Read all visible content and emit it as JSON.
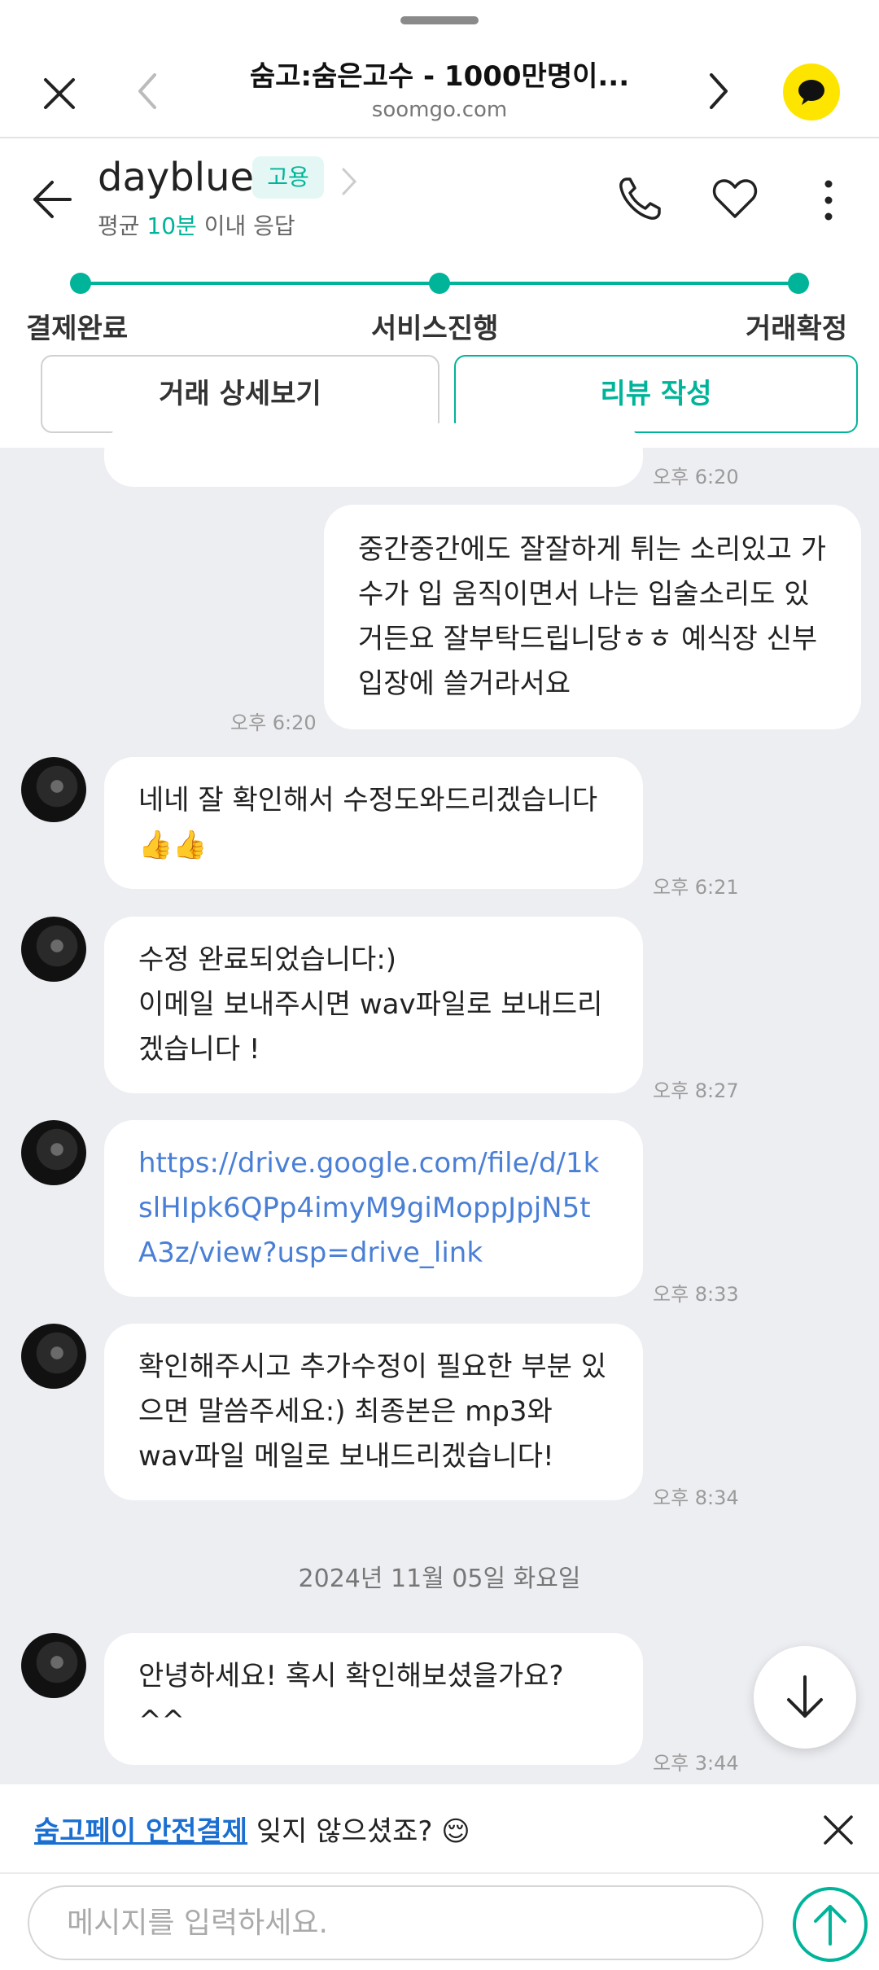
{
  "browser": {
    "title": "숨고:숨은고수 - 1000만명이...",
    "url": "soomgo.com"
  },
  "chat_header": {
    "partner_name": "dayblue",
    "badge": "고용",
    "response_prefix": "평균 ",
    "response_value": "10분",
    "response_suffix": " 이내 응답"
  },
  "progress": {
    "steps": [
      "결제완료",
      "서비스진행",
      "거래확정"
    ]
  },
  "actions": {
    "detail_label": "거래 상세보기",
    "review_label": "리뷰 작성"
  },
  "messages": [
    {
      "side": "right",
      "text": "중간중간에도 잘잘하게 튀는 소리있고 가수가 입 움직이면서 나는 입술소리도 있거든요 잘부탁드립니당ㅎㅎ 예식장 신부입장에 쓸거라서요",
      "time": "오후 6:20"
    },
    {
      "side": "left",
      "text": "네네 잘 확인해서 수정도와드리겠습니다 👍👍",
      "time": "오후 6:21"
    },
    {
      "side": "left",
      "text": "수정 완료되었습니다:)\n이메일 보내주시면 wav파일로 보내드리겠습니다 !",
      "time": "오후 8:27"
    },
    {
      "side": "left",
      "text": "https://drive.google.com/file/d/1kslHIpk6QPp4imyM9giMoppJpjN5tA3z/view?usp=drive_link",
      "time": "오후 8:33"
    },
    {
      "side": "left",
      "text": "확인해주시고 추가수정이 필요한 부분 있으면 말씀주세요:) 최종본은 mp3와 wav파일 메일로 보내드리겠습니다!",
      "time": "오후 8:34"
    },
    {
      "side": "left",
      "text": "안녕하세요! 혹시 확인해보셨을가요?^^",
      "time": "오후 3:44"
    }
  ],
  "top_partial_time": "오후 6:20",
  "date_divider": "2024년 11월 05일 화요일",
  "banner": {
    "link_text": "숨고페이 안전결제",
    "rest_text": " 잊지 않으셨죠? 😌"
  },
  "composer": {
    "placeholder": "메시지를 입력하세요."
  }
}
